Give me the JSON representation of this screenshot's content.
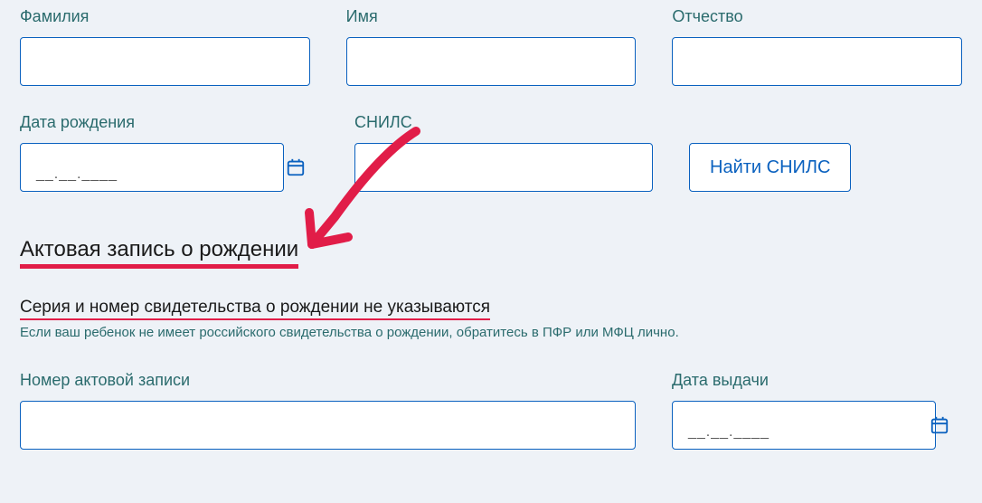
{
  "row1": {
    "surname": {
      "label": "Фамилия",
      "value": ""
    },
    "name": {
      "label": "Имя",
      "value": ""
    },
    "patronymic": {
      "label": "Отчество",
      "value": ""
    }
  },
  "row2": {
    "dob": {
      "label": "Дата рождения",
      "placeholder": "__.__.____"
    },
    "snils": {
      "label": "СНИЛС",
      "value": ""
    },
    "find_btn": "Найти СНИЛС"
  },
  "section": {
    "heading": "Актовая запись о рождении",
    "subheading": "Серия и номер свидетельства о рождении не указываются",
    "helper": "Если ваш ребенок не имеет российского свидетельства о рождении, обратитесь в ПФР или МФЦ лично."
  },
  "row3": {
    "record_no": {
      "label": "Номер актовой записи",
      "value": ""
    },
    "issue_date": {
      "label": "Дата выдачи",
      "placeholder": "__.__.____"
    }
  }
}
